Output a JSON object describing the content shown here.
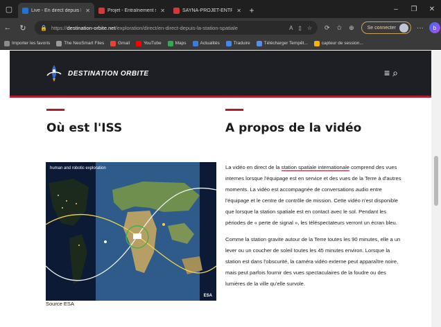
{
  "browser": {
    "tabs": [
      {
        "title": "Live - En direct depuis l'ISS",
        "active": true,
        "favicon_color": "#2a6fd6"
      },
      {
        "title": "Projet - Entraînement sur les bases",
        "active": false,
        "favicon_color": "#d13a3a"
      },
      {
        "title": "SAYNA-PROJET-ENTRAINEMENT",
        "active": false,
        "favicon_color": "#d13a3a"
      }
    ],
    "url_prefix": "https://",
    "url_host": "destination-orbite.net",
    "url_path": "/exploration/direct/en-direct-depuis-la-station-spatiale",
    "signin_label": "Se connecter",
    "bookmarks": [
      {
        "label": "Importer les favoris",
        "color": "#8a8a8a"
      },
      {
        "label": "The NeoSmart Files",
        "color": "#9a9a9a"
      },
      {
        "label": "Gmail",
        "color": "#ea4335"
      },
      {
        "label": "YouTube",
        "color": "#ff0000"
      },
      {
        "label": "Maps",
        "color": "#34a853"
      },
      {
        "label": "Actualités",
        "color": "#3b7ddd"
      },
      {
        "label": "Traduire",
        "color": "#4285f4"
      },
      {
        "label": "Télécharger Tempêt...",
        "color": "#5a8de8"
      },
      {
        "label": "capteur de session...",
        "color": "#f4b400"
      }
    ]
  },
  "site": {
    "logo_text": "DESTINATION ORBITE",
    "accent_color": "#b31b2c",
    "header_color": "#1d1f24"
  },
  "left": {
    "heading": "Où est l'ISS",
    "map_label": "human and robotic exploration",
    "map_footer": "ESA",
    "caption": "Source ESA"
  },
  "right": {
    "heading": "A propos de la vidéo",
    "p1_before": "La vidéo en direct de la ",
    "p1_link": "station spatiale internationale",
    "p1_after": " comprend des vues internes lorsque l'équipage est en service et des vues de la Terre à d'autres moments. La vidéo est accompagnée de conversations audio entre l'équipage et le centre de contrôle de mission. Cette vidéo n'est disponible que lorsque la station spatiale est en contact avec le sol. Pendant les périodes de « perte de signal », les téléspectateurs verront un écran bleu.",
    "p2": "Comme la station gravite autour de la Terre toutes les 90 minutes, elle a un lever ou un coucher de soleil toutes les 45 minutes environ. Lorsque la station est dans l'obscurité, la caméra vidéo externe peut apparaître noire, mais peut parfois fournir des vues spectaculaires de la foudre ou des lumières de la ville qu'elle survole."
  }
}
